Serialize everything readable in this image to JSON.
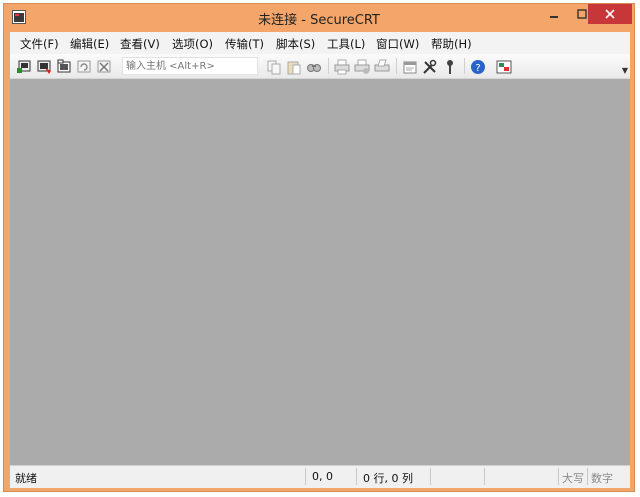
{
  "window": {
    "title": "未连接 - SecureCRT",
    "accent_color": "#f3a56a",
    "close_color": "#c7373a"
  },
  "menu": [
    {
      "label": "文件(F)",
      "key": "file"
    },
    {
      "label": "编辑(E)",
      "key": "edit"
    },
    {
      "label": "查看(V)",
      "key": "view"
    },
    {
      "label": "选项(O)",
      "key": "options"
    },
    {
      "label": "传输(T)",
      "key": "transfer"
    },
    {
      "label": "脚本(S)",
      "key": "script"
    },
    {
      "label": "工具(L)",
      "key": "tools"
    },
    {
      "label": "窗口(W)",
      "key": "window"
    },
    {
      "label": "帮助(H)",
      "key": "help"
    }
  ],
  "toolbar": {
    "host_placeholder": "输入主机 <Alt+R>",
    "icons": [
      "connect-icon",
      "quick-connect-icon",
      "connect-in-tab-icon",
      "reconnect-icon",
      "disconnect-icon",
      "copy-icon",
      "paste-icon",
      "find-icon",
      "print-icon",
      "print-setup-icon",
      "print-selection-icon",
      "session-options-icon",
      "global-options-icon",
      "keymap-icon",
      "help-icon",
      "sftp-icon"
    ]
  },
  "status": {
    "ready": "就绪",
    "position": "0, 0",
    "row_col": "0 行, 0 列",
    "caps": "大写",
    "num": "数字"
  }
}
